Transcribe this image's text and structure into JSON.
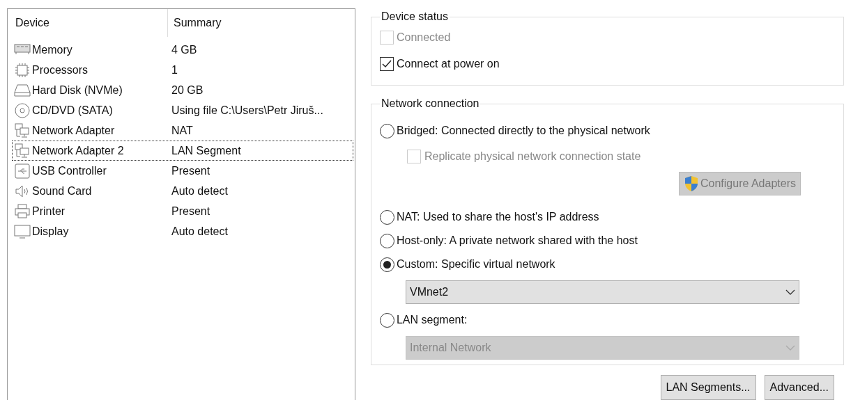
{
  "device_list": {
    "columns": [
      "Device",
      "Summary"
    ],
    "rows": [
      {
        "kind": "memory",
        "device": "Memory",
        "summary": "4 GB",
        "selected": false
      },
      {
        "kind": "processor",
        "device": "Processors",
        "summary": "1",
        "selected": false
      },
      {
        "kind": "disk",
        "device": "Hard Disk (NVMe)",
        "summary": "20 GB",
        "selected": false
      },
      {
        "kind": "cd",
        "device": "CD/DVD (SATA)",
        "summary": "Using file C:\\Users\\Petr Jiruš...",
        "selected": false
      },
      {
        "kind": "network",
        "device": "Network Adapter",
        "summary": "NAT",
        "selected": false
      },
      {
        "kind": "network",
        "device": "Network Adapter 2",
        "summary": "LAN Segment",
        "selected": true
      },
      {
        "kind": "usb",
        "device": "USB Controller",
        "summary": "Present",
        "selected": false
      },
      {
        "kind": "sound",
        "device": "Sound Card",
        "summary": "Auto detect",
        "selected": false
      },
      {
        "kind": "printer",
        "device": "Printer",
        "summary": "Present",
        "selected": false
      },
      {
        "kind": "display",
        "device": "Display",
        "summary": "Auto detect",
        "selected": false
      }
    ]
  },
  "device_status": {
    "title": "Device status",
    "options": [
      {
        "label": "Connected",
        "checked": false,
        "disabled": true
      },
      {
        "label": "Connect at power on",
        "checked": true,
        "disabled": false
      }
    ]
  },
  "network_connection": {
    "title": "Network connection",
    "items": [
      {
        "kind": "radio",
        "label": "Bridged: Connected directly to the physical network",
        "selected": false,
        "disabled": false
      },
      {
        "kind": "checkbox",
        "label": "Replicate physical network connection state",
        "checked": false,
        "disabled": true
      },
      {
        "kind": "button",
        "label": "Configure Adapters",
        "disabled": true
      },
      {
        "kind": "radio",
        "label": "NAT: Used to share the host's IP address",
        "selected": false,
        "disabled": false
      },
      {
        "kind": "radio",
        "label": "Host-only: A private network shared with the host",
        "selected": false,
        "disabled": false
      },
      {
        "kind": "radio",
        "label": "Custom: Specific virtual network",
        "selected": true,
        "disabled": false
      },
      {
        "kind": "select",
        "value": "VMnet2",
        "disabled": false
      },
      {
        "kind": "radio",
        "label": "LAN segment:",
        "selected": false,
        "disabled": false
      },
      {
        "kind": "select",
        "value": "Internal Network",
        "disabled": true
      }
    ]
  },
  "buttons": [
    "LAN Segments...",
    "Advanced..."
  ]
}
